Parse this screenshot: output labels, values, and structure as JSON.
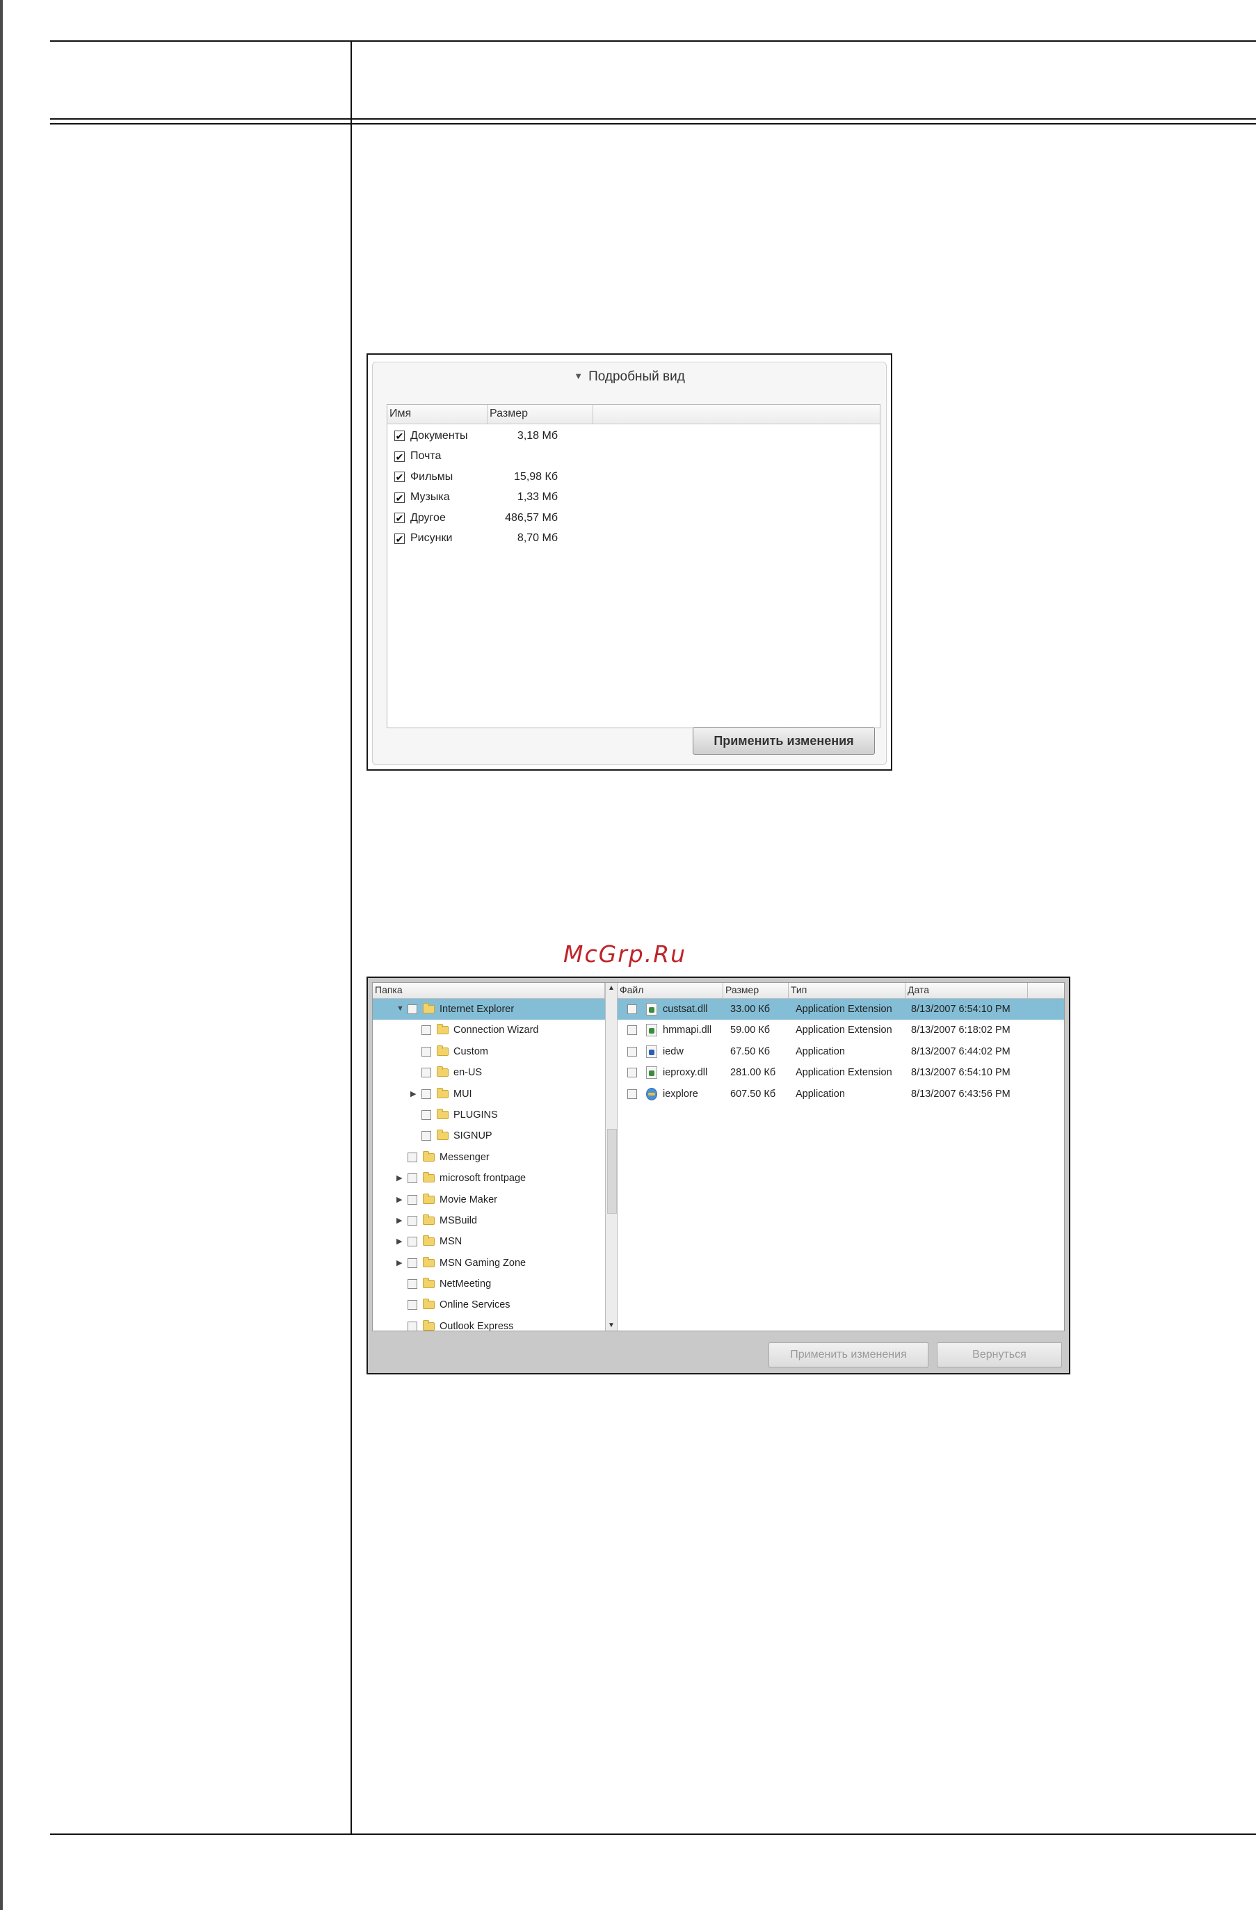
{
  "screenshot1": {
    "title": "Подробный вид",
    "columns": [
      "Имя",
      "Размер"
    ],
    "rows": [
      {
        "name": "Документы",
        "size": "3,18 Мб",
        "checked": true
      },
      {
        "name": "Почта",
        "size": "",
        "checked": true
      },
      {
        "name": "Фильмы",
        "size": "15,98 Кб",
        "checked": true
      },
      {
        "name": "Музыка",
        "size": "1,33 Мб",
        "checked": true
      },
      {
        "name": "Другое",
        "size": "486,57 Мб",
        "checked": true
      },
      {
        "name": "Рисунки",
        "size": "8,70 Мб",
        "checked": true
      }
    ],
    "apply_button": "Применить изменения"
  },
  "watermark": "McGrp.Ru",
  "screenshot2": {
    "tree_header": "Папка",
    "tree": [
      {
        "label": "Internet Explorer",
        "level": 0,
        "expander": "down",
        "selected": true
      },
      {
        "label": "Connection Wizard",
        "level": 1,
        "expander": ""
      },
      {
        "label": "Custom",
        "level": 1,
        "expander": ""
      },
      {
        "label": "en-US",
        "level": 1,
        "expander": ""
      },
      {
        "label": "MUI",
        "level": 1,
        "expander": "right"
      },
      {
        "label": "PLUGINS",
        "level": 1,
        "expander": ""
      },
      {
        "label": "SIGNUP",
        "level": 1,
        "expander": ""
      },
      {
        "label": "Messenger",
        "level": 0,
        "expander": ""
      },
      {
        "label": "microsoft frontpage",
        "level": 0,
        "expander": "right"
      },
      {
        "label": "Movie Maker",
        "level": 0,
        "expander": "right"
      },
      {
        "label": "MSBuild",
        "level": 0,
        "expander": "right"
      },
      {
        "label": "MSN",
        "level": 0,
        "expander": "right"
      },
      {
        "label": "MSN Gaming Zone",
        "level": 0,
        "expander": "right"
      },
      {
        "label": "NetMeeting",
        "level": 0,
        "expander": ""
      },
      {
        "label": "Online Services",
        "level": 0,
        "expander": ""
      },
      {
        "label": "Outlook Express",
        "level": 0,
        "expander": ""
      }
    ],
    "file_columns": [
      "Файл",
      "Размер",
      "Тип",
      "Дата"
    ],
    "files": [
      {
        "name": "custsat.dll",
        "size": "33.00 Кб",
        "type": "Application Extension",
        "date": "8/13/2007 6:54:10 PM",
        "icon": "dll-icon",
        "selected": true
      },
      {
        "name": "hmmapi.dll",
        "size": "59.00 Кб",
        "type": "Application Extension",
        "date": "8/13/2007 6:18:02 PM",
        "icon": "dll-icon",
        "selected": false
      },
      {
        "name": "iedw",
        "size": "67.50 Кб",
        "type": "Application",
        "date": "8/13/2007 6:44:02 PM",
        "icon": "app-icon",
        "selected": false
      },
      {
        "name": "ieproxy.dll",
        "size": "281.00 Кб",
        "type": "Application Extension",
        "date": "8/13/2007 6:54:10 PM",
        "icon": "dll-icon",
        "selected": false
      },
      {
        "name": "iexplore",
        "size": "607.50 Кб",
        "type": "Application",
        "date": "8/13/2007 6:43:56 PM",
        "icon": "ie-icon",
        "selected": false
      }
    ],
    "apply_button": "Применить изменения",
    "back_button": "Вернуться"
  },
  "colors": {
    "selection": "#84bdd6",
    "watermark": "#c0232a"
  }
}
